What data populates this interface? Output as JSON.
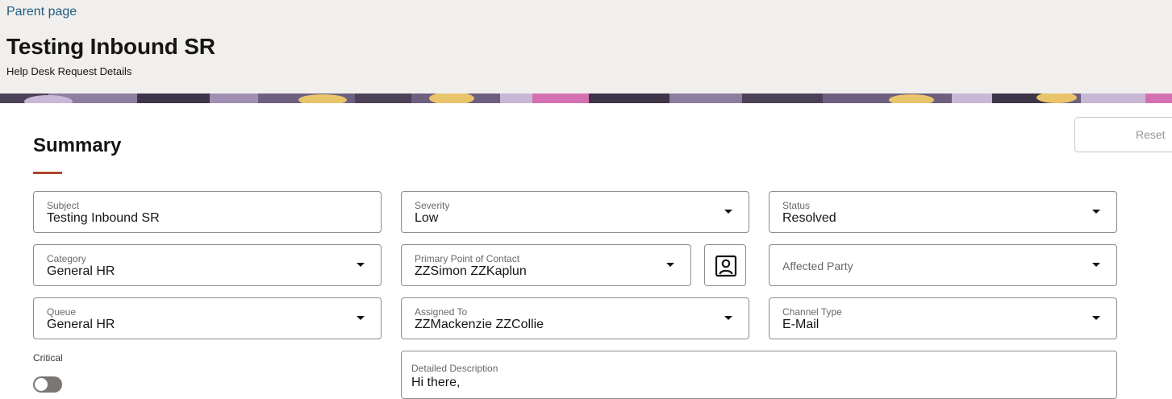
{
  "header": {
    "parent_link": "Parent page",
    "title": "Testing Inbound SR",
    "subtitle": "Help Desk Request Details"
  },
  "toolbar": {
    "reset_label": "Reset"
  },
  "summary": {
    "title": "Summary"
  },
  "fields": {
    "subject": {
      "label": "Subject",
      "value": "Testing Inbound SR"
    },
    "severity": {
      "label": "Severity",
      "value": "Low"
    },
    "status": {
      "label": "Status",
      "value": "Resolved"
    },
    "category": {
      "label": "Category",
      "value": "General HR"
    },
    "primary_contact": {
      "label": "Primary Point of Contact",
      "value": "ZZSimon ZZKaplun"
    },
    "affected_party": {
      "placeholder": "Affected Party"
    },
    "queue": {
      "label": "Queue",
      "value": "General HR"
    },
    "assigned_to": {
      "label": "Assigned To",
      "value": "ZZMackenzie ZZCollie"
    },
    "channel_type": {
      "label": "Channel Type",
      "value": "E-Mail"
    },
    "critical": {
      "label": "Critical",
      "on": false
    },
    "description": {
      "label": "Detailed Description",
      "value": "Hi there,"
    }
  },
  "icons": {
    "contact_picker": "contact-card-icon",
    "dropdown": "caret-down-icon"
  },
  "colors": {
    "header_bg": "#f1efed",
    "link": "#1d5e7f",
    "accent_rule": "#b2442c"
  }
}
